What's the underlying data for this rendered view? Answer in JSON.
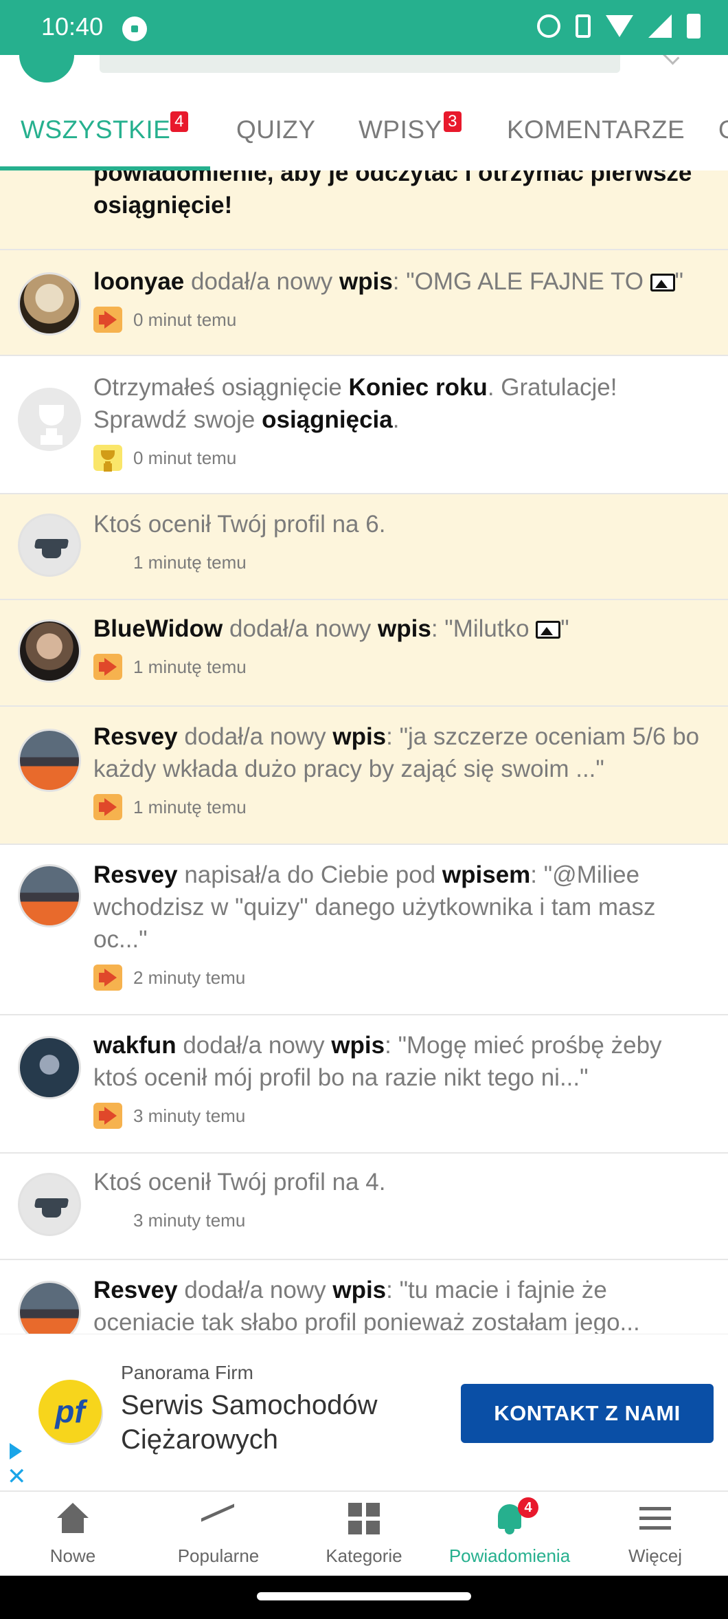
{
  "status_bar": {
    "time": "10:40"
  },
  "tabs": [
    {
      "label": "WSZYSTKIE",
      "badge": "4",
      "active": true
    },
    {
      "label": "QUIZY",
      "badge": "",
      "active": false
    },
    {
      "label": "WPISY",
      "badge": "3",
      "active": false
    },
    {
      "label": "KOMENTARZE",
      "badge": "",
      "active": false
    },
    {
      "label": "O",
      "badge": "",
      "active": false
    }
  ],
  "feed": {
    "top_partial": {
      "line1": "powiadomienie, aby je odczytać i otrzymać pierwsze",
      "line2": "osiągnięcie!"
    },
    "items": [
      {
        "user": "loonyae",
        "verb": "dodał/a nowy",
        "object": "wpis",
        "sep": ": ",
        "quote": "\"OMG ALE FAJNE TO",
        "quote_end": "\"",
        "time": "0 minut temu"
      },
      {
        "p1": "Otrzymałeś osiągnięcie ",
        "b1": "Koniec roku",
        "p2": ". Gratulacje! Sprawdź swoje ",
        "b2": "osiągnięcia",
        "p3": ".",
        "time": "0 minut temu"
      },
      {
        "text": "Ktoś ocenił Twój profil na 6.",
        "time": "1 minutę temu"
      },
      {
        "user": "BlueWidow",
        "verb": "dodał/a nowy",
        "object": "wpis",
        "sep": ": ",
        "quote": "\"Milutko",
        "quote_end": "\"",
        "time": "1 minutę temu"
      },
      {
        "user": "Resvey",
        "verb": "dodał/a nowy",
        "object": "wpis",
        "sep": ": ",
        "quote": "\"ja szczerze oceniam 5/6 bo każdy wkłada dużo pracy by zająć się swoim ...\"",
        "time": "1 minutę temu"
      },
      {
        "user": "Resvey",
        "verb": "napisał/a do Ciebie pod",
        "object": "wpisem",
        "sep": ": ",
        "quote": "\"@Miliee wchodzisz w \"quizy\" danego użytkownika i tam masz oc...\"",
        "time": "2 minuty temu"
      },
      {
        "user": "wakfun",
        "verb": "dodał/a nowy",
        "object": "wpis",
        "sep": ": ",
        "quote": "\"Mogę mieć prośbę żeby ktoś ocenił mój profil bo na razie nikt tego ni...\"",
        "time": "3 minuty temu"
      },
      {
        "text": "Ktoś ocenił Twój profil na 4.",
        "time": "3 minuty temu"
      },
      {
        "user": "Resvey",
        "verb": "dodał/a nowy",
        "object": "wpis",
        "sep": ": ",
        "quote": "\"tu macie i fajnie że oceniacie tak słabo profil ponieważ zostałam jego...",
        "time": ""
      }
    ]
  },
  "ad": {
    "logo_text": "pf",
    "sponsor": "Panorama Firm",
    "title": "Serwis Samochodów Ciężarowych",
    "cta": "KONTAKT Z NAMI"
  },
  "bottom_nav": {
    "items": [
      {
        "label": "Nowe",
        "icon": "home-icon"
      },
      {
        "label": "Popularne",
        "icon": "trending-icon"
      },
      {
        "label": "Kategorie",
        "icon": "grid-icon"
      },
      {
        "label": "Powiadomienia",
        "icon": "bell-icon",
        "badge": "4",
        "active": true
      },
      {
        "label": "Więcej",
        "icon": "menu-icon"
      }
    ]
  },
  "colors": {
    "accent": "#26b08e",
    "unread_bg": "#fdf5dc",
    "badge": "#e8192c",
    "ad_button": "#0a4fa6"
  }
}
